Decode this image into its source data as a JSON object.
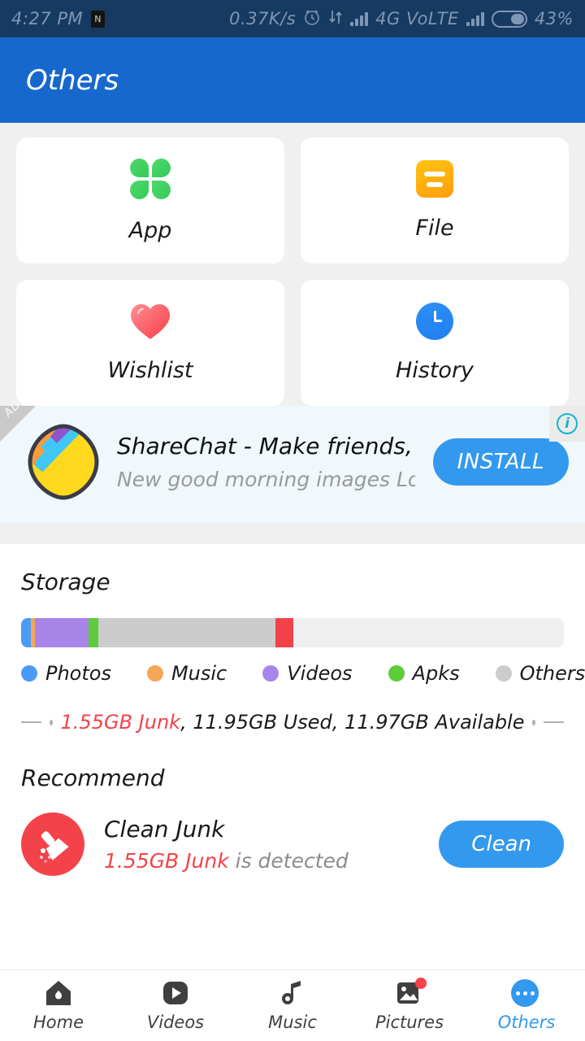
{
  "status_bar": {
    "time": "4:27 PM",
    "notification_icon": "N",
    "network_speed": "0.37K/s",
    "alarm_icon": "alarm-clock-icon",
    "data_transfer_icon": "data-transfer-icon",
    "network_type": "4G VoLTE",
    "battery_percent": "43%",
    "background": "#173a63",
    "foreground": "#7f96b4"
  },
  "app_bar": {
    "title": "Others",
    "background": "#1668cc"
  },
  "grid": {
    "items": [
      {
        "label": "App",
        "icon": "clover-icon",
        "color": "#3ecc5f"
      },
      {
        "label": "File",
        "icon": "file-icon",
        "color": "#ffb20c"
      },
      {
        "label": "Wishlist",
        "icon": "heart-icon",
        "color": "#fa4453"
      },
      {
        "label": "History",
        "icon": "clock-icon",
        "color": "#2585f2"
      }
    ]
  },
  "ad": {
    "ribbon_label": "AD",
    "info_label": "i",
    "logo_icon": "sharechat-logo-icon",
    "title": "ShareChat - Make friends, h…",
    "subtitle": "New good morning images Love song…",
    "install_label": "INSTALL",
    "install_color": "#3399ee",
    "background": "#f0f8fb"
  },
  "storage": {
    "title": "Storage",
    "summary_prefix_junk": "1.55GB Junk",
    "summary_rest": ", 11.95GB Used, 11.97GB Available",
    "legend": [
      {
        "label": "Photos",
        "color": "#4a9bf5"
      },
      {
        "label": "Music",
        "color": "#f5a65a"
      },
      {
        "label": "Videos",
        "color": "#a885e8"
      },
      {
        "label": "Apks",
        "color": "#5ccc3a"
      },
      {
        "label": "Others",
        "color": "#cccccc"
      }
    ]
  },
  "chart_data": {
    "type": "bar",
    "title": "Storage",
    "orientation": "horizontal-stacked",
    "categories": [
      "Photos",
      "Music",
      "Videos",
      "Apks",
      "Others",
      "Junk",
      "Free"
    ],
    "values": [
      0.33,
      0.14,
      1.77,
      0.33,
      5.9,
      0.6,
      9.0
    ],
    "unit": "percent-of-bar",
    "colors": [
      "#4a9bf5",
      "#f5a65a",
      "#a885e8",
      "#5ccc3a",
      "#cccccc",
      "#f4424a",
      "#efefef"
    ],
    "annotations": [
      "1.55GB Junk",
      "11.95GB Used",
      "11.97GB Available"
    ],
    "legend_position": "below",
    "grid": false
  },
  "recommend": {
    "title": "Recommend",
    "item_icon": "broom-icon",
    "item_title": "Clean Junk",
    "item_sub_junk": "1.55GB Junk",
    "item_sub_rest": " is detected",
    "button_label": "Clean",
    "button_color": "#3399ee"
  },
  "bottom_nav": {
    "items": [
      {
        "label": "Home",
        "icon": "home-icon",
        "active": false,
        "badge": false
      },
      {
        "label": "Videos",
        "icon": "play-icon",
        "active": false,
        "badge": false
      },
      {
        "label": "Music",
        "icon": "music-note-icon",
        "active": false,
        "badge": false
      },
      {
        "label": "Pictures",
        "icon": "image-icon",
        "active": false,
        "badge": true
      },
      {
        "label": "Others",
        "icon": "more-dots-icon",
        "active": true,
        "badge": false
      }
    ],
    "active_color": "#3399ee"
  }
}
